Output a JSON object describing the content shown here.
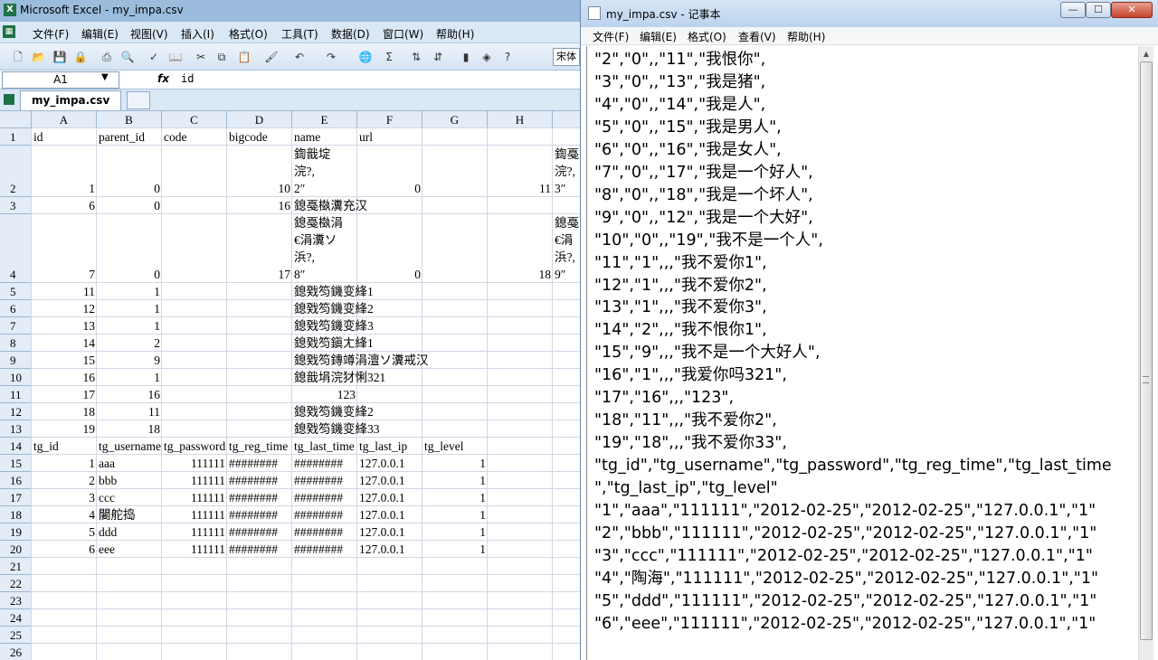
{
  "excel": {
    "title": "Microsoft Excel - my_impa.csv",
    "menu": [
      "文件(F)",
      "编辑(E)",
      "视图(V)",
      "插入(I)",
      "格式(O)",
      "工具(T)",
      "数据(D)",
      "窗口(W)",
      "帮助(H)"
    ],
    "toolbar_icons": [
      "new-icon",
      "open-icon",
      "save-icon",
      "permission-icon",
      "print-icon",
      "print-preview-icon",
      "spelling-icon",
      "research-icon",
      "cut-icon",
      "copy-icon",
      "paste-icon",
      "format-painter-icon",
      "undo-icon",
      "redo-icon",
      "hyperlink-icon",
      "autosum-icon",
      "sort-asc-icon",
      "sort-desc-icon",
      "chart-icon",
      "drawing-icon",
      "help-icon"
    ],
    "font_name": "宋体",
    "name_box": "A1",
    "fx": "fx",
    "formula_value": "id",
    "sheet_tab": "my_impa.csv",
    "columns": [
      "A",
      "B",
      "C",
      "D",
      "E",
      "F",
      "G",
      "H"
    ],
    "row_numbers": [
      "1",
      "2",
      "3",
      "4",
      "5",
      "6",
      "7",
      "8",
      "9",
      "10",
      "11",
      "12",
      "13",
      "14",
      "15",
      "16",
      "17",
      "18",
      "19",
      "20",
      "21",
      "22",
      "23",
      "24",
      "25",
      "26"
    ],
    "cells": [
      [
        "id",
        "parent_id",
        "code",
        "bigcode",
        "name",
        "url",
        "",
        ""
      ],
      [
        "1",
        "0",
        "",
        "10",
        "鍧戠埞\n浣?,\n2″",
        "0",
        "",
        "11"
      ],
      [
        "6",
        "0",
        "",
        "16",
        "鎴戞槸瀵充汉",
        "",
        "",
        ""
      ],
      [
        "7",
        "0",
        "",
        "17",
        "鎴戞槸涓\n€涓瀵ソ\n浜?,\n8″",
        "0",
        "",
        "18"
      ],
      [
        "11",
        "1",
        "",
        "",
        "鎴戣笉鐖变綘1",
        "",
        "",
        ""
      ],
      [
        "12",
        "1",
        "",
        "",
        "鎴戣笉鐖变綘2",
        "",
        "",
        ""
      ],
      [
        "13",
        "1",
        "",
        "",
        "鎴戣笉鐖变綘3",
        "",
        "",
        ""
      ],
      [
        "14",
        "2",
        "",
        "",
        "鎴戣笉鎭ㄤ綘1",
        "",
        "",
        ""
      ],
      [
        "15",
        "9",
        "",
        "",
        "鎴戣笉鏄竴涓澶ソ瀵戒汉",
        "",
        "",
        ""
      ],
      [
        "16",
        "1",
        "",
        "",
        "鎴戠埍浣犲悧321",
        "",
        "",
        ""
      ],
      [
        "17",
        "16",
        "",
        "",
        "123",
        "",
        "",
        ""
      ],
      [
        "18",
        "11",
        "",
        "",
        "鎴戣笉鐖变綘2",
        "",
        "",
        ""
      ],
      [
        "19",
        "18",
        "",
        "",
        "鎴戣笉鐖变綘33",
        "",
        "",
        ""
      ],
      [
        "tg_id",
        "tg_username",
        "tg_password",
        "tg_reg_time",
        "tg_last_time",
        "tg_last_ip",
        "tg_level",
        ""
      ],
      [
        "1",
        "aaa",
        "111111",
        "########",
        "########",
        "127.0.0.1",
        "1",
        ""
      ],
      [
        "2",
        "bbb",
        "111111",
        "########",
        "########",
        "127.0.0.1",
        "1",
        ""
      ],
      [
        "3",
        "ccc",
        "111111",
        "########",
        "########",
        "127.0.0.1",
        "1",
        ""
      ],
      [
        "4",
        "闄舵捣",
        "111111",
        "########",
        "########",
        "127.0.0.1",
        "1",
        ""
      ],
      [
        "5",
        "ddd",
        "111111",
        "########",
        "########",
        "127.0.0.1",
        "1",
        ""
      ],
      [
        "6",
        "eee",
        "111111",
        "########",
        "########",
        "127.0.0.1",
        "1",
        ""
      ]
    ],
    "overflow_col_i": [
      "",
      "鍧戞\n浣?,\n3″",
      "",
      "鎴戞\n€涓\n浜?,\n9″"
    ]
  },
  "notepad": {
    "title": "my_impa.csv - 记事本",
    "window_buttons": [
      "minimize-icon",
      "maximize-icon",
      "close-icon"
    ],
    "menu": [
      "文件(F)",
      "编辑(E)",
      "格式(O)",
      "查看(V)",
      "帮助(H)"
    ],
    "lines": [
      "\"2\",\"0\",,\"11\",\"我恨你\",",
      "\"3\",\"0\",,\"13\",\"我是猪\",",
      "\"4\",\"0\",,\"14\",\"我是人\",",
      "\"5\",\"0\",,\"15\",\"我是男人\",",
      "\"6\",\"0\",,\"16\",\"我是女人\",",
      "\"7\",\"0\",,\"17\",\"我是一个好人\",",
      "\"8\",\"0\",,\"18\",\"我是一个坏人\",",
      "\"9\",\"0\",,\"12\",\"我是一个大好\",",
      "\"10\",\"0\",,\"19\",\"我不是一个人\",",
      "\"11\",\"1\",,,\"我不爱你1\",",
      "\"12\",\"1\",,,\"我不爱你2\",",
      "\"13\",\"1\",,,\"我不爱你3\",",
      "\"14\",\"2\",,,\"我不恨你1\",",
      "\"15\",\"9\",,,\"我不是一个大好人\",",
      "\"16\",\"1\",,,\"我爱你吗321\",",
      "\"17\",\"16\",,,\"123\",",
      "\"18\",\"11\",,,\"我不爱你2\",",
      "\"19\",\"18\",,,\"我不爱你33\",",
      "\"tg_id\",\"tg_username\",\"tg_password\",\"tg_reg_time\",\"tg_last_time",
      "\",\"tg_last_ip\",\"tg_level\"",
      "\"1\",\"aaa\",\"111111\",\"2012-02-25\",\"2012-02-25\",\"127.0.0.1\",\"1\"",
      "\"2\",\"bbb\",\"111111\",\"2012-02-25\",\"2012-02-25\",\"127.0.0.1\",\"1\"",
      "\"3\",\"ccc\",\"111111\",\"2012-02-25\",\"2012-02-25\",\"127.0.0.1\",\"1\"",
      "\"4\",\"陶海\",\"111111\",\"2012-02-25\",\"2012-02-25\",\"127.0.0.1\",\"1\"",
      "\"5\",\"ddd\",\"111111\",\"2012-02-25\",\"2012-02-25\",\"127.0.0.1\",\"1\"",
      "\"6\",\"eee\",\"111111\",\"2012-02-25\",\"2012-02-25\",\"127.0.0.1\",\"1\""
    ]
  }
}
